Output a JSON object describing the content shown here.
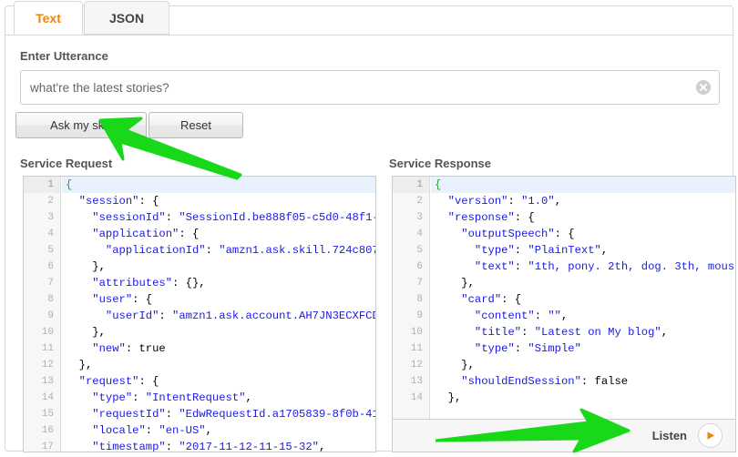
{
  "tabs": [
    {
      "label": "Text",
      "active": true
    },
    {
      "label": "JSON",
      "active": false
    }
  ],
  "utterance": {
    "label": "Enter Utterance",
    "value": "what're the latest stories?",
    "placeholder": "what're the latest stories?",
    "clear_icon": "clear-circle-x-icon"
  },
  "buttons": {
    "ask": "Ask my skill",
    "reset": "Reset"
  },
  "request": {
    "header": "Service Request",
    "lines": [
      {
        "n": "1",
        "text": "{",
        "hl": true
      },
      {
        "n": "2",
        "text": "  \"session\": {"
      },
      {
        "n": "3",
        "text": "    \"sessionId\": \"SessionId.be888f05-c5d0-48f1-"
      },
      {
        "n": "4",
        "text": "    \"application\": {"
      },
      {
        "n": "5",
        "text": "      \"applicationId\": \"amzn1.ask.skill.724c807"
      },
      {
        "n": "6",
        "text": "    },"
      },
      {
        "n": "7",
        "text": "    \"attributes\": {},"
      },
      {
        "n": "8",
        "text": "    \"user\": {"
      },
      {
        "n": "9",
        "text": "      \"userId\": \"amzn1.ask.account.AH7JN3ECXFCD"
      },
      {
        "n": "10",
        "text": "    },"
      },
      {
        "n": "11",
        "text": "    \"new\": true"
      },
      {
        "n": "12",
        "text": "  },"
      },
      {
        "n": "13",
        "text": "  \"request\": {"
      },
      {
        "n": "14",
        "text": "    \"type\": \"IntentRequest\","
      },
      {
        "n": "15",
        "text": "    \"requestId\": \"EdwRequestId.a1705839-8f0b-41"
      },
      {
        "n": "16",
        "text": "    \"locale\": \"en-US\","
      },
      {
        "n": "17",
        "text": "    \"timestamp\": \"2017-11-12-11-15-32\","
      }
    ]
  },
  "response": {
    "header": "Service Response",
    "lines": [
      {
        "n": "1",
        "text": "{",
        "hl": true
      },
      {
        "n": "2",
        "text": "  \"version\": \"1.0\","
      },
      {
        "n": "3",
        "text": "  \"response\": {"
      },
      {
        "n": "4",
        "text": "    \"outputSpeech\": {"
      },
      {
        "n": "5",
        "text": "      \"type\": \"PlainText\","
      },
      {
        "n": "6",
        "text": "      \"text\": \"1th, pony. 2th, dog. 3th, mous"
      },
      {
        "n": "7",
        "text": "    },"
      },
      {
        "n": "8",
        "text": "    \"card\": {"
      },
      {
        "n": "9",
        "text": "      \"content\": \"\","
      },
      {
        "n": "10",
        "text": "      \"title\": \"Latest on My blog\","
      },
      {
        "n": "11",
        "text": "      \"type\": \"Simple\""
      },
      {
        "n": "12",
        "text": "    },"
      },
      {
        "n": "13",
        "text": "    \"shouldEndSession\": false"
      },
      {
        "n": "14",
        "text": "  },"
      }
    ]
  },
  "listen": {
    "label": "Listen",
    "play_icon": "play-triangle-icon"
  },
  "annotations": [
    {
      "name": "arrow-pointing-to-ask-my-skill",
      "direction": "up-left"
    },
    {
      "name": "arrow-pointing-to-listen",
      "direction": "right"
    }
  ],
  "colors": {
    "accent": "#e8870a",
    "arrow": "#22dd22",
    "json_string": "#1a1ae6",
    "active_line": "#e8f2fe"
  }
}
